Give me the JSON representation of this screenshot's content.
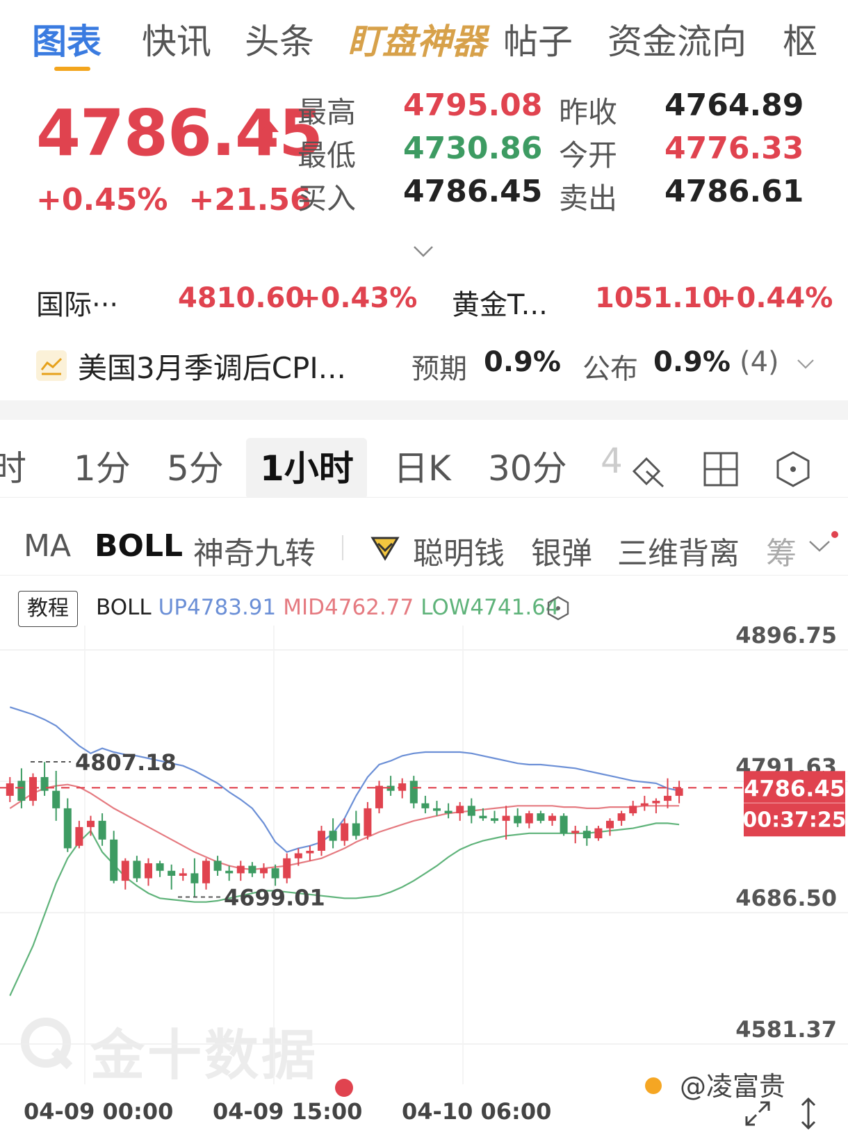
{
  "tabs": [
    {
      "label": "图表",
      "style": "active"
    },
    {
      "label": "快讯",
      "style": "normal"
    },
    {
      "label": "头条",
      "style": "normal"
    },
    {
      "label": "盯盘神器",
      "style": "gold"
    },
    {
      "label": "帖子",
      "style": "normal"
    },
    {
      "label": "资金流向",
      "style": "normal"
    },
    {
      "label": "枢",
      "style": "normal"
    }
  ],
  "quote": {
    "price": "4786.45",
    "change_pct": "+0.45%",
    "change_abs": "+21.56",
    "stats": {
      "high_label": "最高",
      "high": "4795.08",
      "low_label": "最低",
      "low": "4730.86",
      "bid_label": "买入",
      "bid": "4786.45",
      "prev_close_label": "昨收",
      "prev_close": "4764.89",
      "open_label": "今开",
      "open": "4776.33",
      "ask_label": "卖出",
      "ask": "4786.61"
    }
  },
  "related": [
    {
      "name": "国际···",
      "price": "4810.60",
      "change": "+0.43%"
    },
    {
      "name": "黄金T...",
      "price": "1051.10",
      "change": "+0.44%"
    }
  ],
  "event": {
    "title": "美国3月季调后CPI...",
    "expect_label": "预期",
    "expect_value": "0.9%",
    "actual_label": "公布",
    "actual_value": "0.9%",
    "count": "(4)"
  },
  "periods": [
    "时",
    "1分",
    "5分",
    "1小时",
    "日K",
    "30分",
    "4"
  ],
  "active_period": "1小时",
  "indicators": {
    "ma": "MA",
    "boll": "BOLL",
    "nine": "神奇九转",
    "smart": "聪明钱",
    "bullet": "银弹",
    "divergence": "三维背离",
    "chip": "筹"
  },
  "chart_header": {
    "tutorial": "教程",
    "name": "BOLL",
    "up": "UP4783.91",
    "mid": "MID4762.77",
    "low": "LOW4741.64"
  },
  "colors": {
    "up_candle": "#e0434f",
    "down_candle": "#3d9b62",
    "boll_up": "#6b8fd6",
    "boll_mid": "#e57a80",
    "boll_low": "#5fb37a",
    "accent_blue": "#3a7be0",
    "accent_gold": "#d7a14a"
  },
  "chart_data": {
    "type": "candlestick",
    "ylim": [
      4581.37,
      4896.75
    ],
    "y_ticks": [
      "4896.75",
      "4791.63",
      "4686.50",
      "4581.37"
    ],
    "x_ticks": [
      "04-09 00:00",
      "04-09 15:00",
      "04-10 06:00"
    ],
    "high_marker": "4807.18",
    "low_marker": "4699.01",
    "last_price": "4786.45",
    "countdown": "00:37:25",
    "candles": [
      [
        4780,
        4795,
        4775,
        4790
      ],
      [
        4792,
        4802,
        4770,
        4776
      ],
      [
        4776,
        4798,
        4772,
        4795
      ],
      [
        4795,
        4807,
        4780,
        4784
      ],
      [
        4784,
        4800,
        4760,
        4770
      ],
      [
        4770,
        4778,
        4735,
        4738
      ],
      [
        4740,
        4760,
        4738,
        4755
      ],
      [
        4755,
        4764,
        4748,
        4760
      ],
      [
        4760,
        4766,
        4740,
        4745
      ],
      [
        4745,
        4752,
        4710,
        4712
      ],
      [
        4712,
        4730,
        4705,
        4728
      ],
      [
        4728,
        4732,
        4711,
        4714
      ],
      [
        4714,
        4730,
        4708,
        4726
      ],
      [
        4726,
        4728,
        4715,
        4720
      ],
      [
        4720,
        4725,
        4705,
        4716
      ],
      [
        4716,
        4722,
        4712,
        4718
      ],
      [
        4718,
        4730,
        4699,
        4710
      ],
      [
        4710,
        4730,
        4705,
        4728
      ],
      [
        4728,
        4732,
        4716,
        4720
      ],
      [
        4720,
        4724,
        4712,
        4718
      ],
      [
        4718,
        4728,
        4712,
        4724
      ],
      [
        4724,
        4727,
        4715,
        4718
      ],
      [
        4718,
        4726,
        4714,
        4722
      ],
      [
        4722,
        4725,
        4708,
        4714
      ],
      [
        4714,
        4734,
        4710,
        4730
      ],
      [
        4730,
        4738,
        4724,
        4734
      ],
      [
        4734,
        4740,
        4728,
        4736
      ],
      [
        4736,
        4756,
        4732,
        4752
      ],
      [
        4752,
        4762,
        4738,
        4744
      ],
      [
        4744,
        4762,
        4740,
        4758
      ],
      [
        4758,
        4768,
        4745,
        4748
      ],
      [
        4748,
        4775,
        4745,
        4770
      ],
      [
        4770,
        4792,
        4766,
        4788
      ],
      [
        4788,
        4796,
        4780,
        4784
      ],
      [
        4784,
        4794,
        4778,
        4790
      ],
      [
        4792,
        4796,
        4770,
        4774
      ],
      [
        4774,
        4780,
        4766,
        4770
      ],
      [
        4770,
        4776,
        4764,
        4768
      ],
      [
        4768,
        4774,
        4762,
        4766
      ],
      [
        4766,
        4775,
        4760,
        4772
      ],
      [
        4772,
        4778,
        4758,
        4764
      ],
      [
        4764,
        4770,
        4760,
        4762
      ],
      [
        4762,
        4768,
        4758,
        4760
      ],
      [
        4760,
        4772,
        4745,
        4764
      ],
      [
        4764,
        4770,
        4755,
        4758
      ],
      [
        4758,
        4768,
        4754,
        4766
      ],
      [
        4766,
        4768,
        4758,
        4760
      ],
      [
        4760,
        4766,
        4756,
        4764
      ],
      [
        4764,
        4766,
        4748,
        4750
      ],
      [
        4750,
        4756,
        4742,
        4752
      ],
      [
        4752,
        4756,
        4740,
        4746
      ],
      [
        4746,
        4756,
        4744,
        4754
      ],
      [
        4754,
        4762,
        4748,
        4760
      ],
      [
        4760,
        4768,
        4756,
        4766
      ],
      [
        4766,
        4776,
        4764,
        4772
      ],
      [
        4772,
        4780,
        4768,
        4774
      ],
      [
        4774,
        4778,
        4766,
        4776
      ],
      [
        4776,
        4794,
        4770,
        4780
      ],
      [
        4780,
        4792,
        4774,
        4786
      ]
    ],
    "boll_up": [
      4851,
      4848,
      4845,
      4841,
      4836,
      4828,
      4820,
      4814,
      4818,
      4815,
      4813,
      4812,
      4810,
      4808,
      4806,
      4804,
      4800,
      4795,
      4790,
      4783,
      4777,
      4770,
      4758,
      4743,
      4735,
      4738,
      4740,
      4743,
      4750,
      4762,
      4780,
      4795,
      4805,
      4808,
      4812,
      4814,
      4815,
      4815,
      4815,
      4815,
      4814,
      4812,
      4810,
      4808,
      4806,
      4805,
      4805,
      4804,
      4803,
      4802,
      4800,
      4798,
      4796,
      4794,
      4792,
      4791,
      4790,
      4786,
      4784
    ],
    "boll_mid": [
      4770,
      4776,
      4782,
      4786,
      4788,
      4789,
      4787,
      4782,
      4776,
      4770,
      4765,
      4760,
      4755,
      4750,
      4745,
      4740,
      4735,
      4731,
      4727,
      4724,
      4722,
      4721,
      4722,
      4723,
      4724,
      4726,
      4728,
      4730,
      4734,
      4738,
      4743,
      4747,
      4751,
      4754,
      4757,
      4760,
      4762,
      4764,
      4766,
      4767,
      4768,
      4769,
      4770,
      4771,
      4772,
      4772,
      4772,
      4772,
      4771,
      4771,
      4770,
      4770,
      4771,
      4771,
      4771,
      4772,
      4772,
      4772,
      4772
    ],
    "boll_low": [
      4620,
      4640,
      4660,
      4685,
      4710,
      4730,
      4743,
      4752,
      4735,
      4725,
      4715,
      4708,
      4702,
      4698,
      4697,
      4696,
      4695,
      4695,
      4696,
      4698,
      4700,
      4702,
      4704,
      4704,
      4703,
      4702,
      4701,
      4700,
      4699,
      4698,
      4698,
      4699,
      4700,
      4703,
      4707,
      4712,
      4718,
      4724,
      4731,
      4737,
      4741,
      4744,
      4746,
      4748,
      4749,
      4750,
      4750,
      4750,
      4750,
      4750,
      4750,
      4751,
      4752,
      4753,
      4754,
      4756,
      4758,
      4758,
      4757
    ]
  },
  "watermark": "金十数据",
  "credit": "@凌富贵"
}
